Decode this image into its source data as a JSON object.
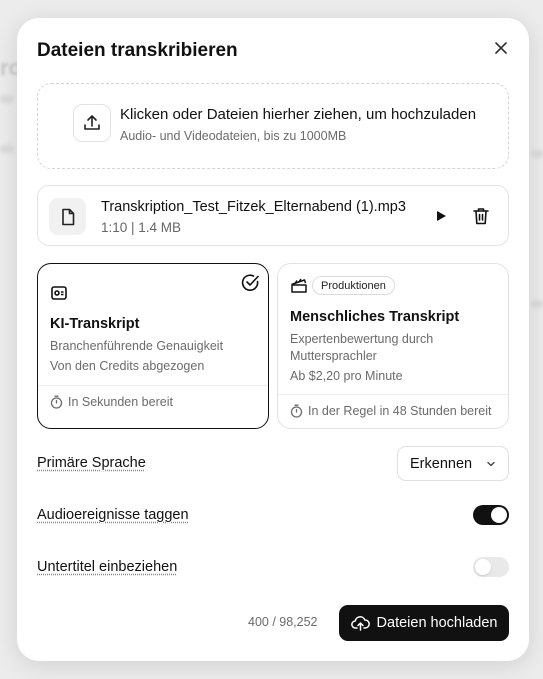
{
  "background": {
    "partial_text": "ro"
  },
  "dialog": {
    "title": "Dateien transkribieren",
    "close_icon": "close-icon"
  },
  "dropzone": {
    "title": "Klicken oder Dateien hierher ziehen, um hochzuladen",
    "subtitle": "Audio- und Videodateien, bis zu 1000MB",
    "icon": "upload-icon"
  },
  "file": {
    "name": "Transkription_Test_Fitzek_Elternabend (1).mp3",
    "meta": "1:10 | 1.4 MB",
    "icon": "file-icon"
  },
  "options": {
    "ai": {
      "title": "KI-Transkript",
      "line1": "Branchenführende Genauigkeit",
      "line2": "Von den Credits abgezogen",
      "eta": "In Sekunden bereit",
      "selected": true
    },
    "human": {
      "badge": "Produktionen",
      "title": "Menschliches Transkript",
      "line1": "Expertenbewertung durch Muttersprachler",
      "line2": "Ab $2,20 pro Minute",
      "eta": "In der Regel in 48 Stunden bereit",
      "selected": false
    }
  },
  "settings": {
    "language_label": "Primäre Sprache",
    "language_value": "Erkennen",
    "audio_events_label": "Audioereignisse taggen",
    "audio_events_on": true,
    "subtitles_label": "Untertitel einbeziehen",
    "subtitles_on": false
  },
  "footer": {
    "counter": "400 / 98,252",
    "upload_label": "Dateien hochladen"
  },
  "colors": {
    "primary": "#111111",
    "muted": "#6b6b6b",
    "border": "#e2e2e2"
  }
}
